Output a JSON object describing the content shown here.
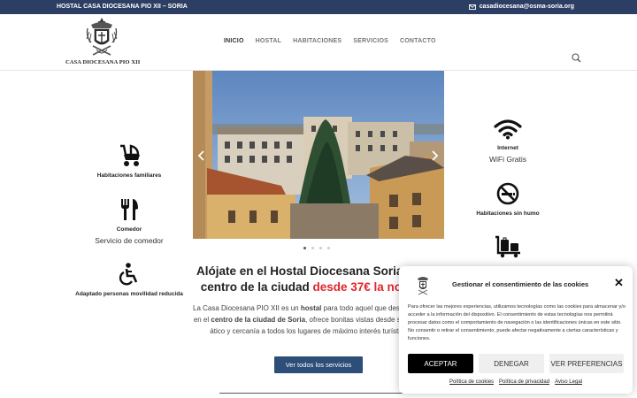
{
  "topbar": {
    "title": "HOSTAL CASA DIOCESANA PIO XII – SORIA",
    "email": "casadiocesana@osma-soria.org"
  },
  "logo": {
    "text": "CASA DIOCESANA PIO XII"
  },
  "nav": {
    "items": [
      "INICIO",
      "HOSTAL",
      "HABITACIONES",
      "SERVICIOS",
      "CONTACTO"
    ]
  },
  "features": {
    "family": {
      "title": "Habitaciones familiares",
      "icon": "baby-stroller-icon"
    },
    "dining": {
      "title": "Comedor",
      "subtitle": "Servicio de comedor",
      "icon": "utensils-icon"
    },
    "accessible": {
      "title": "Adaptado personas movilidad reducida",
      "icon": "wheelchair-icon"
    },
    "internet": {
      "title": "Internet",
      "subtitle": "WiFi Gratis",
      "icon": "wifi-icon"
    },
    "nosmoking": {
      "title": "Habitaciones sin humo",
      "icon": "no-smoking-icon"
    },
    "luggage": {
      "icon": "luggage-cart-icon"
    }
  },
  "slider": {
    "active_index": 0,
    "count": 4
  },
  "main": {
    "headline_line1": "Alójate en el Hostal Diocesana Soria en el",
    "headline_line2a": "centro de la ciudad ",
    "headline_line2b": "desde 37€ la noche",
    "intro_1a": "La Casa Diocesana PIO XII es un ",
    "intro_1b": "hostal",
    "intro_1c": " para todo aquel que desee alojarse",
    "intro_2a": "en el ",
    "intro_2b": "centro de la ciudad de Soria",
    "intro_2c": ", ofrece bonitas vistas desde su planta",
    "intro_3": "ático y cercanía a todos los lugares de máximo interés turístico.",
    "cta": "Ver todos los servicios"
  },
  "cookie": {
    "title": "Gestionar el consentimiento de las cookies",
    "text": "Para ofrecer las mejores experiencias, utilizamos tecnologías como las cookies para almacenar y/o acceder a la información del dispositivo. El consentimiento de estas tecnologías nos permitirá procesar datos como el comportamiento de navegación o las identificaciones únicas en este sitio. No consentir o retirar el consentimiento, puede afectar negativamente a ciertas características y funciones.",
    "accept": "ACEPTAR",
    "deny": "DENEGAR",
    "prefs": "VER PREFERENCIAS",
    "links": [
      "Política de cookies",
      "Política de privacidad",
      "Aviso Legal"
    ]
  },
  "colors": {
    "topbar": "#2c3e63",
    "price": "#e0252c",
    "button": "#2c4e78"
  }
}
